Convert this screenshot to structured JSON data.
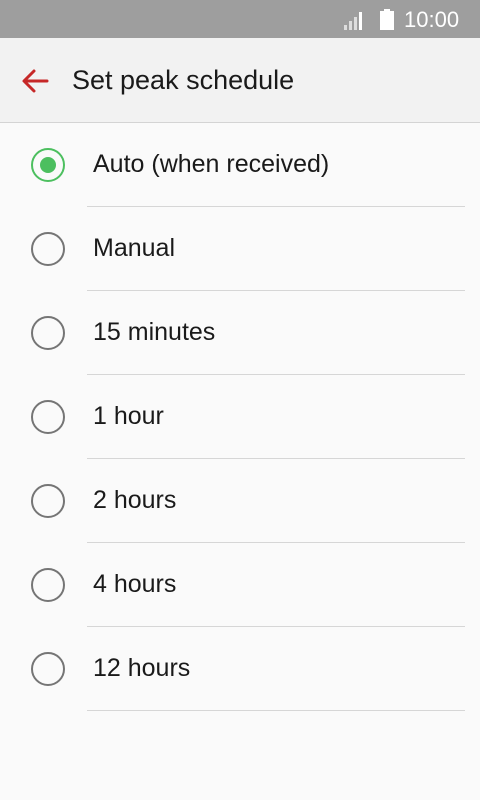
{
  "status_bar": {
    "time": "10:00",
    "icons": [
      "signal-icon",
      "battery-icon"
    ]
  },
  "app_bar": {
    "back_icon": "back-arrow-icon",
    "title": "Set peak schedule"
  },
  "colors": {
    "accent": "#4cbf5f",
    "back_arrow": "#c62828",
    "status_bar_bg": "#9e9e9e"
  },
  "options": [
    {
      "label": "Auto (when received)",
      "selected": true
    },
    {
      "label": "Manual",
      "selected": false
    },
    {
      "label": "15 minutes",
      "selected": false
    },
    {
      "label": "1 hour",
      "selected": false
    },
    {
      "label": "2 hours",
      "selected": false
    },
    {
      "label": "4 hours",
      "selected": false
    },
    {
      "label": "12 hours",
      "selected": false
    }
  ]
}
